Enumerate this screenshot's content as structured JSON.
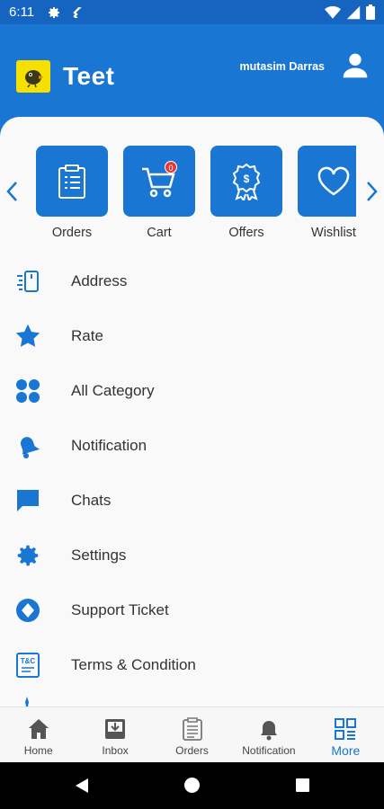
{
  "status_bar": {
    "time": "6:11"
  },
  "header": {
    "brand": "Teet",
    "username": "mutasim Darras"
  },
  "quick_actions": [
    {
      "label": "Orders",
      "icon": "clipboard-icon"
    },
    {
      "label": "Cart",
      "icon": "cart-icon",
      "badge": "0"
    },
    {
      "label": "Offers",
      "icon": "offer-badge-icon"
    },
    {
      "label": "Wishlist",
      "icon": "heart-icon"
    }
  ],
  "menu": [
    {
      "label": "Address",
      "icon": "address-icon"
    },
    {
      "label": "Rate",
      "icon": "star-icon"
    },
    {
      "label": "All Category",
      "icon": "category-grid-icon"
    },
    {
      "label": "Notification",
      "icon": "bell-icon"
    },
    {
      "label": "Chats",
      "icon": "chat-icon"
    },
    {
      "label": "Settings",
      "icon": "gear-icon"
    },
    {
      "label": "Support Ticket",
      "icon": "support-icon"
    },
    {
      "label": "Terms & Condition",
      "icon": "terms-icon"
    }
  ],
  "bottom_nav": [
    {
      "label": "Home",
      "icon": "home-icon"
    },
    {
      "label": "Inbox",
      "icon": "inbox-icon"
    },
    {
      "label": "Orders",
      "icon": "orders-icon"
    },
    {
      "label": "Notification",
      "icon": "bell-icon"
    },
    {
      "label": "More",
      "icon": "more-grid-icon",
      "active": true
    }
  ],
  "colors": {
    "primary": "#1976d2",
    "status_bar": "#1565c0",
    "badge": "#e53935",
    "background": "#f9f9f9"
  }
}
